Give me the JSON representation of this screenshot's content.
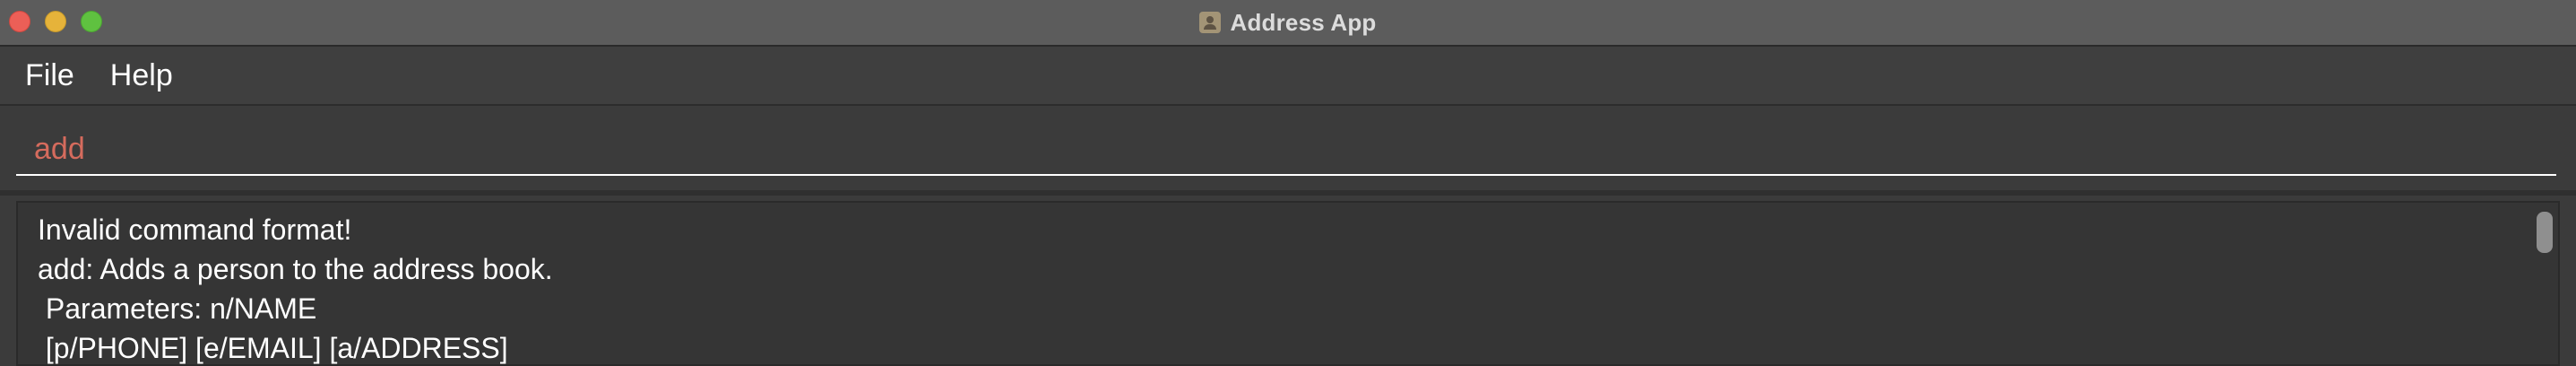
{
  "window": {
    "title": "Address App",
    "app_icon": "address-book-icon"
  },
  "menu": {
    "items": [
      {
        "label": "File"
      },
      {
        "label": "Help"
      }
    ]
  },
  "command_box": {
    "value": "add",
    "text_color": "#d56b5d"
  },
  "result_display": {
    "lines": [
      "Invalid command format!",
      "add: Adds a person to the address book.",
      " Parameters: n/NAME",
      " [p/PHONE] [e/EMAIL] [a/ADDRESS]"
    ]
  },
  "colors": {
    "close": "#ec5f57",
    "minimize": "#e6b33a",
    "zoom": "#5fc140",
    "background": "#3b3b3b"
  }
}
